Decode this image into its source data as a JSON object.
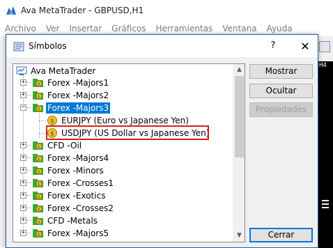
{
  "app": {
    "title": "Ava MetaTrader - GBPUSD,H1",
    "menu": [
      "Archivo",
      "Ver",
      "Insertar",
      "Gráficos",
      "Herramientas",
      "Ventana",
      "Ayuda"
    ],
    "chart_side_label": "H4"
  },
  "dialog": {
    "title": "Símbolos",
    "help_glyph": "?",
    "close_glyph": "✕",
    "tree": {
      "root": "Ava MetaTrader",
      "groups": [
        {
          "label": "Forex -Majors1",
          "expanded": false
        },
        {
          "label": "Forex -Majors2",
          "expanded": false
        },
        {
          "label": "Forex -Majors3",
          "expanded": true,
          "selected": true,
          "children": [
            {
              "label": "EURJPY  (Euro vs Japanese Yen)"
            },
            {
              "label": "USDJPY  (US Dollar vs Japanese Yen)",
              "highlighted": true
            }
          ]
        },
        {
          "label": "CFD -Oil",
          "expanded": false
        },
        {
          "label": "Forex -Majors4",
          "expanded": false
        },
        {
          "label": "Forex -Minors",
          "expanded": false
        },
        {
          "label": "Forex -Crosses1",
          "expanded": false
        },
        {
          "label": "Forex -Exotics",
          "expanded": false
        },
        {
          "label": "Forex -Crosses2",
          "expanded": false
        },
        {
          "label": "CFD -Metals",
          "expanded": false
        },
        {
          "label": "Forex -Majors5",
          "expanded": false
        }
      ]
    },
    "buttons": {
      "show": "Mostrar",
      "hide": "Ocultar",
      "properties": "Propiedades",
      "close": "Cerrar"
    }
  },
  "colors": {
    "selection": "#0078d7",
    "highlight_border": "#d81e1e",
    "folder_green": "#3aa935",
    "coin_gold": "#e2b000"
  },
  "icons": {
    "app": "metatrader-logo-icon",
    "dialog": "symbols-icon",
    "root": "terminal-icon",
    "group": "folder-dollar-icon",
    "symbol": "coin-dollar-icon"
  }
}
